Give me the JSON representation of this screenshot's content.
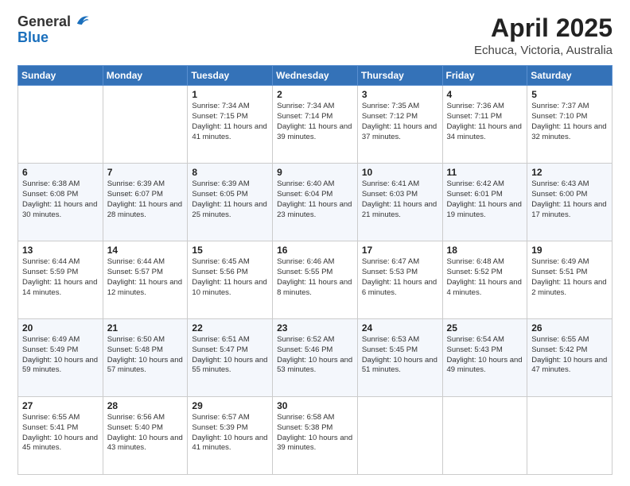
{
  "header": {
    "logo_general": "General",
    "logo_blue": "Blue",
    "month": "April 2025",
    "location": "Echuca, Victoria, Australia"
  },
  "weekdays": [
    "Sunday",
    "Monday",
    "Tuesday",
    "Wednesday",
    "Thursday",
    "Friday",
    "Saturday"
  ],
  "weeks": [
    [
      {
        "day": "",
        "content": ""
      },
      {
        "day": "",
        "content": ""
      },
      {
        "day": "1",
        "content": "Sunrise: 7:34 AM\nSunset: 7:15 PM\nDaylight: 11 hours and 41 minutes."
      },
      {
        "day": "2",
        "content": "Sunrise: 7:34 AM\nSunset: 7:14 PM\nDaylight: 11 hours and 39 minutes."
      },
      {
        "day": "3",
        "content": "Sunrise: 7:35 AM\nSunset: 7:12 PM\nDaylight: 11 hours and 37 minutes."
      },
      {
        "day": "4",
        "content": "Sunrise: 7:36 AM\nSunset: 7:11 PM\nDaylight: 11 hours and 34 minutes."
      },
      {
        "day": "5",
        "content": "Sunrise: 7:37 AM\nSunset: 7:10 PM\nDaylight: 11 hours and 32 minutes."
      }
    ],
    [
      {
        "day": "6",
        "content": "Sunrise: 6:38 AM\nSunset: 6:08 PM\nDaylight: 11 hours and 30 minutes."
      },
      {
        "day": "7",
        "content": "Sunrise: 6:39 AM\nSunset: 6:07 PM\nDaylight: 11 hours and 28 minutes."
      },
      {
        "day": "8",
        "content": "Sunrise: 6:39 AM\nSunset: 6:05 PM\nDaylight: 11 hours and 25 minutes."
      },
      {
        "day": "9",
        "content": "Sunrise: 6:40 AM\nSunset: 6:04 PM\nDaylight: 11 hours and 23 minutes."
      },
      {
        "day": "10",
        "content": "Sunrise: 6:41 AM\nSunset: 6:03 PM\nDaylight: 11 hours and 21 minutes."
      },
      {
        "day": "11",
        "content": "Sunrise: 6:42 AM\nSunset: 6:01 PM\nDaylight: 11 hours and 19 minutes."
      },
      {
        "day": "12",
        "content": "Sunrise: 6:43 AM\nSunset: 6:00 PM\nDaylight: 11 hours and 17 minutes."
      }
    ],
    [
      {
        "day": "13",
        "content": "Sunrise: 6:44 AM\nSunset: 5:59 PM\nDaylight: 11 hours and 14 minutes."
      },
      {
        "day": "14",
        "content": "Sunrise: 6:44 AM\nSunset: 5:57 PM\nDaylight: 11 hours and 12 minutes."
      },
      {
        "day": "15",
        "content": "Sunrise: 6:45 AM\nSunset: 5:56 PM\nDaylight: 11 hours and 10 minutes."
      },
      {
        "day": "16",
        "content": "Sunrise: 6:46 AM\nSunset: 5:55 PM\nDaylight: 11 hours and 8 minutes."
      },
      {
        "day": "17",
        "content": "Sunrise: 6:47 AM\nSunset: 5:53 PM\nDaylight: 11 hours and 6 minutes."
      },
      {
        "day": "18",
        "content": "Sunrise: 6:48 AM\nSunset: 5:52 PM\nDaylight: 11 hours and 4 minutes."
      },
      {
        "day": "19",
        "content": "Sunrise: 6:49 AM\nSunset: 5:51 PM\nDaylight: 11 hours and 2 minutes."
      }
    ],
    [
      {
        "day": "20",
        "content": "Sunrise: 6:49 AM\nSunset: 5:49 PM\nDaylight: 10 hours and 59 minutes."
      },
      {
        "day": "21",
        "content": "Sunrise: 6:50 AM\nSunset: 5:48 PM\nDaylight: 10 hours and 57 minutes."
      },
      {
        "day": "22",
        "content": "Sunrise: 6:51 AM\nSunset: 5:47 PM\nDaylight: 10 hours and 55 minutes."
      },
      {
        "day": "23",
        "content": "Sunrise: 6:52 AM\nSunset: 5:46 PM\nDaylight: 10 hours and 53 minutes."
      },
      {
        "day": "24",
        "content": "Sunrise: 6:53 AM\nSunset: 5:45 PM\nDaylight: 10 hours and 51 minutes."
      },
      {
        "day": "25",
        "content": "Sunrise: 6:54 AM\nSunset: 5:43 PM\nDaylight: 10 hours and 49 minutes."
      },
      {
        "day": "26",
        "content": "Sunrise: 6:55 AM\nSunset: 5:42 PM\nDaylight: 10 hours and 47 minutes."
      }
    ],
    [
      {
        "day": "27",
        "content": "Sunrise: 6:55 AM\nSunset: 5:41 PM\nDaylight: 10 hours and 45 minutes."
      },
      {
        "day": "28",
        "content": "Sunrise: 6:56 AM\nSunset: 5:40 PM\nDaylight: 10 hours and 43 minutes."
      },
      {
        "day": "29",
        "content": "Sunrise: 6:57 AM\nSunset: 5:39 PM\nDaylight: 10 hours and 41 minutes."
      },
      {
        "day": "30",
        "content": "Sunrise: 6:58 AM\nSunset: 5:38 PM\nDaylight: 10 hours and 39 minutes."
      },
      {
        "day": "",
        "content": ""
      },
      {
        "day": "",
        "content": ""
      },
      {
        "day": "",
        "content": ""
      }
    ]
  ]
}
